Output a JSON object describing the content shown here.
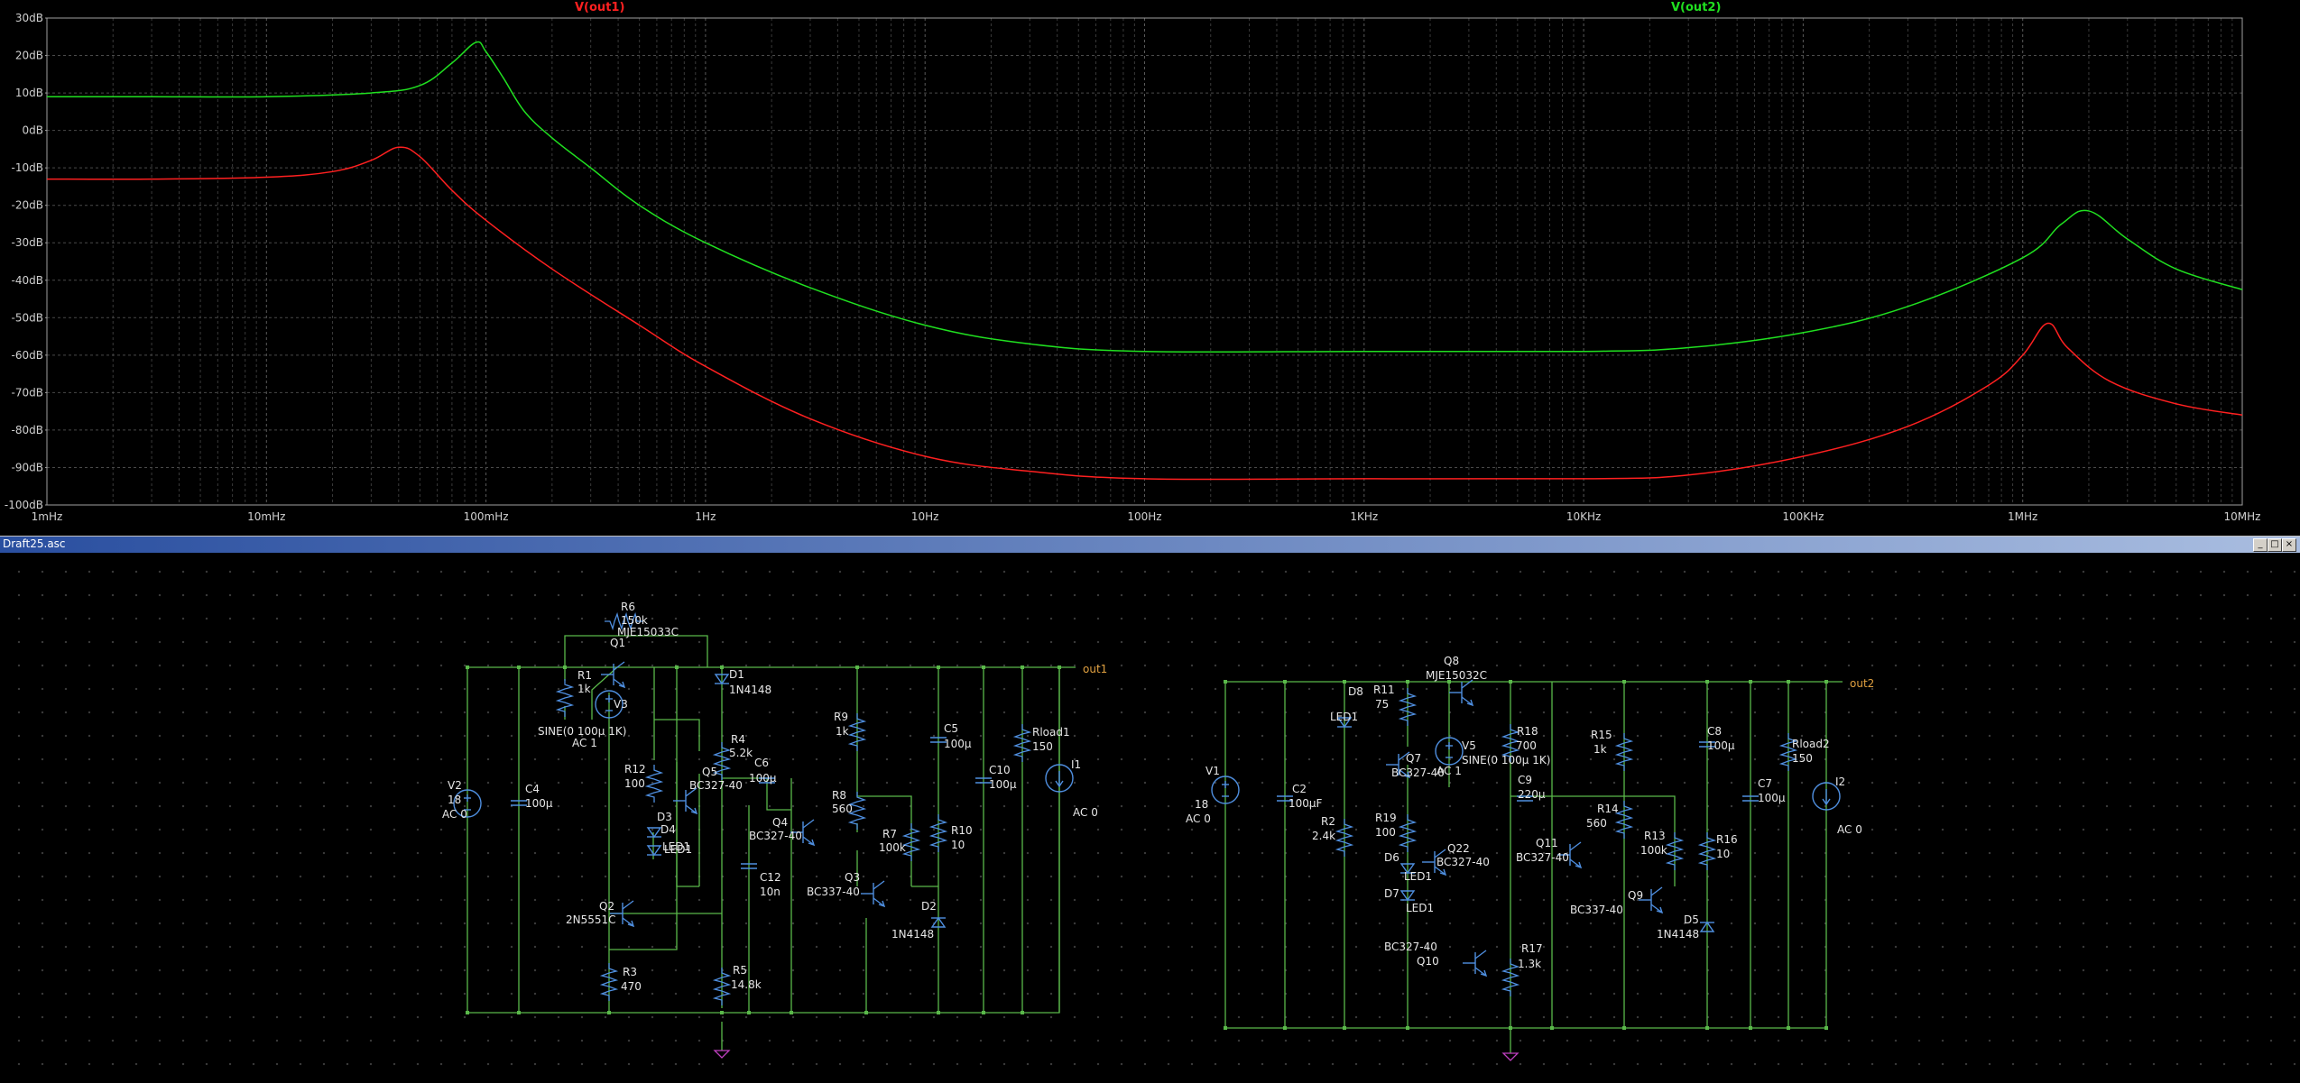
{
  "plot": {
    "traces": [
      {
        "name": "V(out1)",
        "color": "#ff2020"
      },
      {
        "name": "V(out2)",
        "color": "#20e020"
      }
    ],
    "y_ticks": [
      "30dB",
      "20dB",
      "10dB",
      "0dB",
      "-10dB",
      "-20dB",
      "-30dB",
      "-40dB",
      "-50dB",
      "-60dB",
      "-70dB",
      "-80dB",
      "-90dB",
      "-100dB"
    ],
    "x_ticks": [
      "1mHz",
      "10mHz",
      "100mHz",
      "1Hz",
      "10Hz",
      "100Hz",
      "1KHz",
      "10KHz",
      "100KHz",
      "1MHz",
      "10MHz"
    ],
    "chart_data": {
      "type": "line",
      "title": "",
      "xlabel": "",
      "ylabel": "",
      "x_scale": "log",
      "xlim": [
        "1mHz",
        "10MHz"
      ],
      "ylim": [
        -100,
        30
      ],
      "grid": true,
      "series": [
        {
          "name": "V(out1)",
          "x": [
            0.001,
            0.003,
            0.01,
            0.02,
            0.03,
            0.04,
            0.05,
            0.07,
            0.1,
            0.2,
            0.5,
            1,
            3,
            10,
            30,
            100,
            1000,
            10000,
            30000,
            100000,
            300000,
            700000,
            1000000,
            1300000,
            1600000,
            2500000,
            5000000,
            10000000
          ],
          "y": [
            -13,
            -13,
            -12.5,
            -11,
            -8,
            -4.5,
            -7,
            -16,
            -24,
            -37,
            -52,
            -63,
            -77,
            -87,
            -91,
            -93,
            -93,
            -93,
            -92,
            -87,
            -79,
            -68,
            -60,
            -51.5,
            -58,
            -67,
            -73,
            -76
          ]
        },
        {
          "name": "V(out2)",
          "x": [
            0.001,
            0.003,
            0.01,
            0.03,
            0.05,
            0.07,
            0.09,
            0.1,
            0.12,
            0.15,
            0.2,
            0.3,
            0.5,
            1,
            3,
            10,
            30,
            100,
            1000,
            10000,
            30000,
            100000,
            300000,
            1000000,
            1500000,
            2000000,
            3000000,
            5000000,
            10000000
          ],
          "y": [
            9,
            9,
            9,
            10,
            12,
            18,
            23.5,
            21,
            14,
            5,
            -2,
            -10,
            -20,
            -30,
            -42,
            -52,
            -57,
            -59,
            -59,
            -59,
            -58,
            -54,
            -47,
            -34,
            -25,
            -21.5,
            -29,
            -37,
            -42.5
          ]
        }
      ]
    }
  },
  "window": {
    "title": "Draft25.asc",
    "buttons": [
      "_",
      "□",
      "×"
    ]
  },
  "schematic": {
    "labels": [
      {
        "text": "R6"
      },
      {
        "text": "150k"
      },
      {
        "text": "MJE15033C"
      },
      {
        "text": "Q1"
      },
      {
        "text": "R1"
      },
      {
        "text": "1k"
      },
      {
        "text": "V3"
      },
      {
        "text": "SINE(0 100µ 1K)"
      },
      {
        "text": "AC 1"
      },
      {
        "text": "D1"
      },
      {
        "text": "1N4148"
      },
      {
        "text": "out1"
      },
      {
        "text": "V2"
      },
      {
        "text": "18"
      },
      {
        "text": "AC 0"
      },
      {
        "text": "C4"
      },
      {
        "text": "100µ"
      },
      {
        "text": "R12"
      },
      {
        "text": "100"
      },
      {
        "text": "Q5"
      },
      {
        "text": "BC327-40"
      },
      {
        "text": "R4"
      },
      {
        "text": "5.2k"
      },
      {
        "text": "C6"
      },
      {
        "text": "100µ"
      },
      {
        "text": "R9"
      },
      {
        "text": "1k"
      },
      {
        "text": "C5"
      },
      {
        "text": "100µ"
      },
      {
        "text": "Rload1"
      },
      {
        "text": "150"
      },
      {
        "text": "I1"
      },
      {
        "text": "AC 0"
      },
      {
        "text": "C10"
      },
      {
        "text": "100µ"
      },
      {
        "text": "D3"
      },
      {
        "text": "LED1"
      },
      {
        "text": "D4"
      },
      {
        "text": "LED1"
      },
      {
        "text": "R8"
      },
      {
        "text": "560"
      },
      {
        "text": "Q4"
      },
      {
        "text": "BC327-40"
      },
      {
        "text": "R7"
      },
      {
        "text": "100k"
      },
      {
        "text": "R10"
      },
      {
        "text": "10"
      },
      {
        "text": "C12"
      },
      {
        "text": "10n"
      },
      {
        "text": "Q3"
      },
      {
        "text": "BC337-40"
      },
      {
        "text": "Q2"
      },
      {
        "text": "2N5551C"
      },
      {
        "text": "D2"
      },
      {
        "text": "1N4148"
      },
      {
        "text": "R3"
      },
      {
        "text": "470"
      },
      {
        "text": "R5"
      },
      {
        "text": "14.8k"
      },
      {
        "text": "Q8"
      },
      {
        "text": "MJE15032C"
      },
      {
        "text": "R11"
      },
      {
        "text": "75"
      },
      {
        "text": "D8"
      },
      {
        "text": "LED1"
      },
      {
        "text": "out2"
      },
      {
        "text": "V1"
      },
      {
        "text": "18"
      },
      {
        "text": "AC 0"
      },
      {
        "text": "C2"
      },
      {
        "text": "100µF"
      },
      {
        "text": "Q7"
      },
      {
        "text": "BC327-40"
      },
      {
        "text": "V5"
      },
      {
        "text": "SINE(0 100µ 1K)"
      },
      {
        "text": "AC 1"
      },
      {
        "text": "R18"
      },
      {
        "text": "700"
      },
      {
        "text": "R15"
      },
      {
        "text": "1k"
      },
      {
        "text": "C8"
      },
      {
        "text": "100µ"
      },
      {
        "text": "Rload2"
      },
      {
        "text": "150"
      },
      {
        "text": "I2"
      },
      {
        "text": "AC 0"
      },
      {
        "text": "R2"
      },
      {
        "text": "2.4k"
      },
      {
        "text": "R19"
      },
      {
        "text": "100"
      },
      {
        "text": "C9"
      },
      {
        "text": "220µ"
      },
      {
        "text": "R14"
      },
      {
        "text": "560"
      },
      {
        "text": "C7"
      },
      {
        "text": "100µ"
      },
      {
        "text": "D6"
      },
      {
        "text": "LED1"
      },
      {
        "text": "Q22"
      },
      {
        "text": "BC327-40"
      },
      {
        "text": "Q11"
      },
      {
        "text": "BC327-40"
      },
      {
        "text": "R13"
      },
      {
        "text": "100k"
      },
      {
        "text": "R16"
      },
      {
        "text": "10"
      },
      {
        "text": "D7"
      },
      {
        "text": "LED1"
      },
      {
        "text": "Q9"
      },
      {
        "text": "BC337-40"
      },
      {
        "text": "D5"
      },
      {
        "text": "1N4148"
      },
      {
        "text": "BC327-40"
      },
      {
        "text": "Q10"
      },
      {
        "text": "R17"
      },
      {
        "text": "1.3k"
      }
    ]
  }
}
